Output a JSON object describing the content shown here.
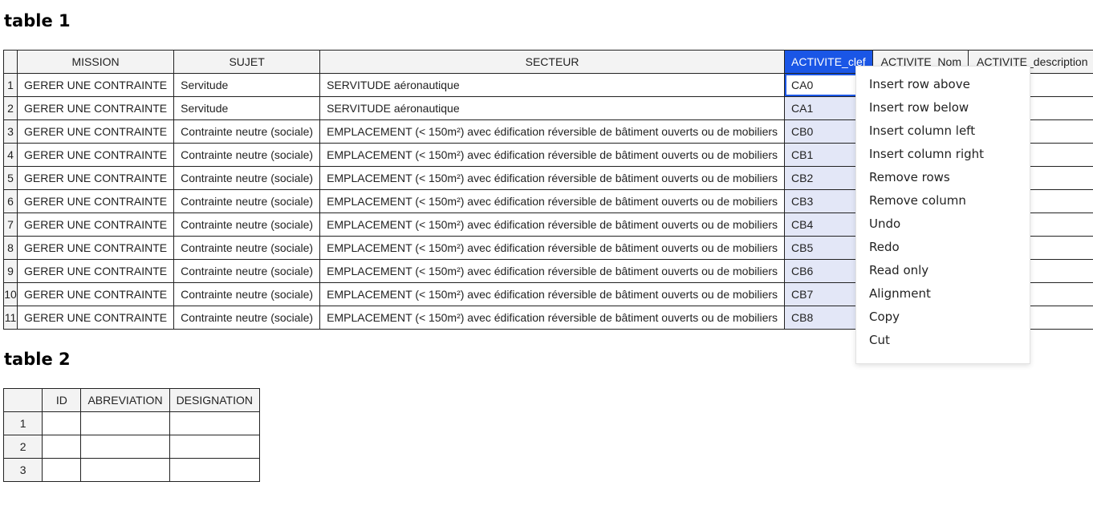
{
  "table1": {
    "title": "table 1",
    "columns": [
      "MISSION",
      "SUJET",
      "SECTEUR",
      "ACTIVITE_clef",
      "ACTIVITE_Nom",
      "ACTIVITE_description"
    ],
    "rows": [
      {
        "n": "1",
        "mission": "GERER UNE CONTRAINTE",
        "sujet": "Servitude",
        "secteur": "SERVITUDE aéronautique",
        "clef": "CA0"
      },
      {
        "n": "2",
        "mission": "GERER UNE CONTRAINTE",
        "sujet": "Servitude",
        "secteur": "SERVITUDE aéronautique",
        "clef": "CA1"
      },
      {
        "n": "3",
        "mission": "GERER UNE CONTRAINTE",
        "sujet": "Contrainte neutre (sociale)",
        "secteur": "EMPLACEMENT (< 150m²) avec édification réversible de bâtiment ouverts ou de mobiliers",
        "clef": "CB0"
      },
      {
        "n": "4",
        "mission": "GERER UNE CONTRAINTE",
        "sujet": "Contrainte neutre (sociale)",
        "secteur": "EMPLACEMENT (< 150m²) avec édification réversible de bâtiment ouverts ou de mobiliers",
        "clef": "CB1"
      },
      {
        "n": "5",
        "mission": "GERER UNE CONTRAINTE",
        "sujet": "Contrainte neutre (sociale)",
        "secteur": "EMPLACEMENT (< 150m²) avec édification réversible de bâtiment ouverts ou de mobiliers",
        "clef": "CB2"
      },
      {
        "n": "6",
        "mission": "GERER UNE CONTRAINTE",
        "sujet": "Contrainte neutre (sociale)",
        "secteur": "EMPLACEMENT (< 150m²) avec édification réversible de bâtiment ouverts ou de mobiliers",
        "clef": "CB3"
      },
      {
        "n": "7",
        "mission": "GERER UNE CONTRAINTE",
        "sujet": "Contrainte neutre (sociale)",
        "secteur": "EMPLACEMENT (< 150m²) avec édification réversible de bâtiment ouverts ou de mobiliers",
        "clef": "CB4"
      },
      {
        "n": "8",
        "mission": "GERER UNE CONTRAINTE",
        "sujet": "Contrainte neutre (sociale)",
        "secteur": "EMPLACEMENT (< 150m²) avec édification réversible de bâtiment ouverts ou de mobiliers",
        "clef": "CB5"
      },
      {
        "n": "9",
        "mission": "GERER UNE CONTRAINTE",
        "sujet": "Contrainte neutre (sociale)",
        "secteur": "EMPLACEMENT (< 150m²) avec édification réversible de bâtiment ouverts ou de mobiliers",
        "clef": "CB6"
      },
      {
        "n": "10",
        "mission": "GERER UNE CONTRAINTE",
        "sujet": "Contrainte neutre (sociale)",
        "secteur": "EMPLACEMENT (< 150m²) avec édification réversible de bâtiment ouverts ou de mobiliers",
        "clef": "CB7"
      },
      {
        "n": "11",
        "mission": "GERER UNE CONTRAINTE",
        "sujet": "Contrainte neutre (sociale)",
        "secteur": "EMPLACEMENT (< 150m²) avec édification réversible de bâtiment ouverts ou de mobiliers",
        "clef": "CB8"
      }
    ]
  },
  "table2": {
    "title": "table 2",
    "columns": [
      "ID",
      "ABREVIATION",
      "DESIGNATION"
    ],
    "row_numbers": [
      "1",
      "2",
      "3"
    ]
  },
  "context_menu": {
    "items": [
      "Insert row above",
      "Insert row below",
      "Insert column left",
      "Insert column right",
      "Remove rows",
      "Remove column",
      "Undo",
      "Redo",
      "Read only",
      "Alignment",
      "Copy",
      "Cut"
    ]
  },
  "colors": {
    "selected_header": "#1a56e6",
    "selected_cells": "#e3e7f7",
    "header_background": "#f3f3f3"
  }
}
